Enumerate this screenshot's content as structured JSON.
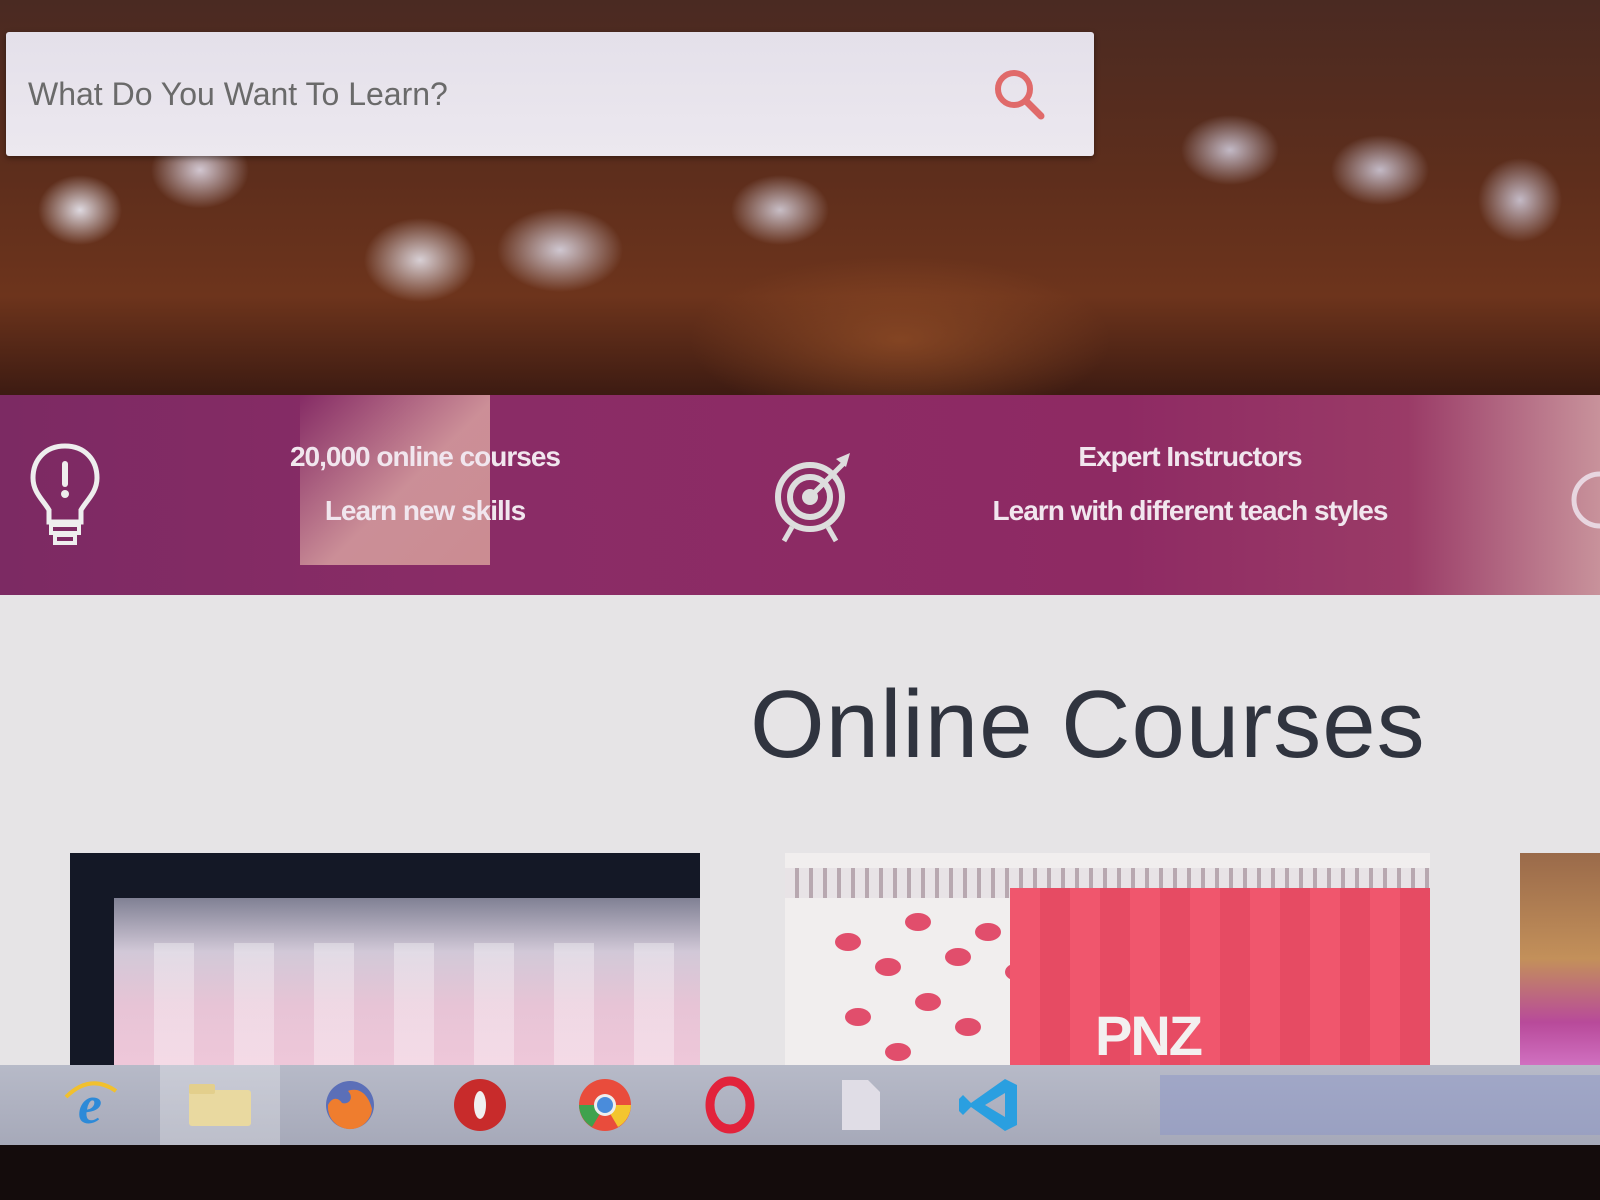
{
  "search": {
    "placeholder": "What Do You Want To Learn?"
  },
  "features": [
    {
      "icon": "lightbulb-icon",
      "title": "20,000 online courses",
      "subtitle": "Learn new skills"
    },
    {
      "icon": "target-icon",
      "title": "Expert Instructors",
      "subtitle": "Learn with different teach styles"
    }
  ],
  "main": {
    "title": "Online Courses",
    "cards": [
      {
        "name": "course-card-1"
      },
      {
        "name": "course-card-2",
        "caption": "PNZ"
      },
      {
        "name": "course-card-3"
      }
    ]
  },
  "taskbar": {
    "items": [
      "internet-explorer-icon",
      "file-explorer-icon",
      "firefox-icon",
      "opera-red-icon",
      "chrome-icon",
      "opera-icon",
      "file-icon",
      "vscode-icon"
    ]
  },
  "colors": {
    "accent": "#8a2c66",
    "search_icon": "#e06a6a",
    "title_text": "#30343f"
  }
}
